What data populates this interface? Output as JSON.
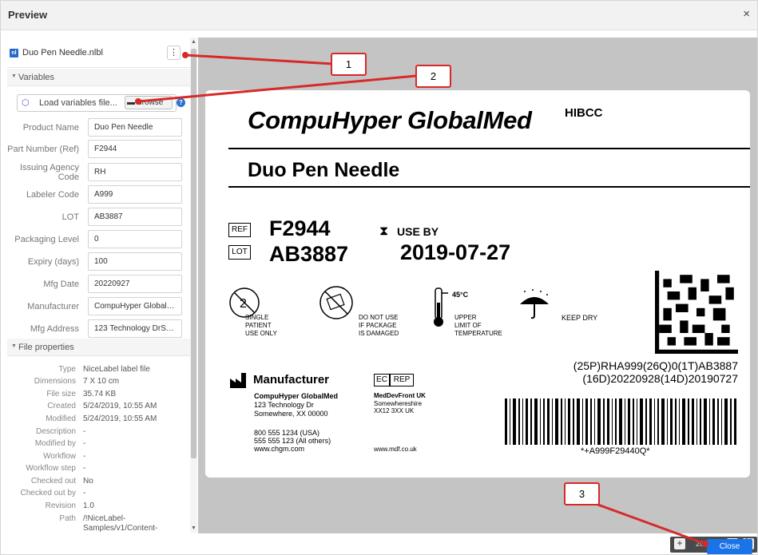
{
  "window": {
    "title": "Preview",
    "close_glyph": "×"
  },
  "file": {
    "icon_text": "nl",
    "name": "Duo Pen Needle.nlbl",
    "menu_glyph": "⋮"
  },
  "variables_section": {
    "label": "Variables",
    "load_label": "Load variables file...",
    "browse_label": "Browse",
    "help_glyph": "?"
  },
  "variables": [
    {
      "label": "Product Name",
      "value": "Duo Pen Needle"
    },
    {
      "label": "Part Number (Ref)",
      "value": "F2944"
    },
    {
      "label": "Issuing Agency Code",
      "value": "RH"
    },
    {
      "label": "Labeler Code",
      "value": "A999"
    },
    {
      "label": "LOT",
      "value": "AB3887"
    },
    {
      "label": "Packaging Level",
      "value": "0"
    },
    {
      "label": "Expiry (days)",
      "value": "100"
    },
    {
      "label": "Mfg Date",
      "value": "20220927"
    },
    {
      "label": "Manufacturer",
      "value": "CompuHyper GlobalMed"
    },
    {
      "label": "Mfg Address",
      "value": "123 Technology DrSom..."
    }
  ],
  "file_properties_section": {
    "label": "File properties"
  },
  "file_properties": [
    {
      "label": "Type",
      "value": "NiceLabel label file"
    },
    {
      "label": "Dimensions",
      "value": "7 X 10 cm"
    },
    {
      "label": "File size",
      "value": "35.74 KB"
    },
    {
      "label": "Created",
      "value": "5/24/2019, 10:55 AM"
    },
    {
      "label": "Modified",
      "value": "5/24/2019, 10:55 AM"
    },
    {
      "label": "Description",
      "value": "-"
    },
    {
      "label": "Modified by",
      "value": "-"
    },
    {
      "label": "Workflow",
      "value": "-"
    },
    {
      "label": "Workflow step",
      "value": "-"
    },
    {
      "label": "Checked out",
      "value": "No"
    },
    {
      "label": "Checked out by",
      "value": "-"
    },
    {
      "label": "Revision",
      "value": "1.0"
    },
    {
      "label": "Path",
      "value": "/!NiceLabel-Samples/v1/Content-"
    }
  ],
  "label_preview": {
    "company": "CompuHyper GlobalMed",
    "hibcc": "HIBCC",
    "product": "Duo Pen Needle",
    "ref_symbol": "REF",
    "ref_value": "F2944",
    "lot_symbol": "LOT",
    "lot_value": "AB3887",
    "use_by_label": "USE BY",
    "use_by_value": "2019-07-27",
    "single_use": [
      "SINGLE",
      "PATIENT",
      "USE ONLY"
    ],
    "do_not_use": [
      "DO NOT USE",
      "IF PACKAGE",
      "IS DAMAGED"
    ],
    "temp_value": "45°C",
    "temp_text": [
      "UPPER",
      "LIMIT OF",
      "TEMPERATURE"
    ],
    "keep_dry": "KEEP DRY",
    "hri_line1": "(25P)RHA999(26Q)0(1T)AB3887",
    "hri_line2": "(16D)20220928(14D)20190727",
    "manufacturer_heading": "Manufacturer",
    "mfg_name": "CompuHyper GlobalMed",
    "mfg_addr1": "123 Technology Dr",
    "mfg_addr2": "Somewhere, XX 00000",
    "mfg_phone1": "800 555 1234 (USA)",
    "mfg_phone2": "555 555 123 (All others)",
    "mfg_web": "www.chgm.com",
    "ecrep_ec": "EC",
    "ecrep_rep": "REP",
    "rep_name": "MedDevFront UK",
    "rep_addr1": "Somewhereshire",
    "rep_addr2": "XX12 3XX UK",
    "rep_web": "www.mdf.co.uk",
    "barcode_text": "*+A999F29440Q*"
  },
  "zoom": {
    "plus": "+",
    "percent": "203.3%",
    "minus": "−",
    "fit": "⛶"
  },
  "footer": {
    "close_label": "Close"
  },
  "callouts": [
    "1",
    "2",
    "3"
  ],
  "colors": {
    "accent": "#1a73e8",
    "callout": "#d62a2a",
    "canvas": "#c4c4c4"
  }
}
